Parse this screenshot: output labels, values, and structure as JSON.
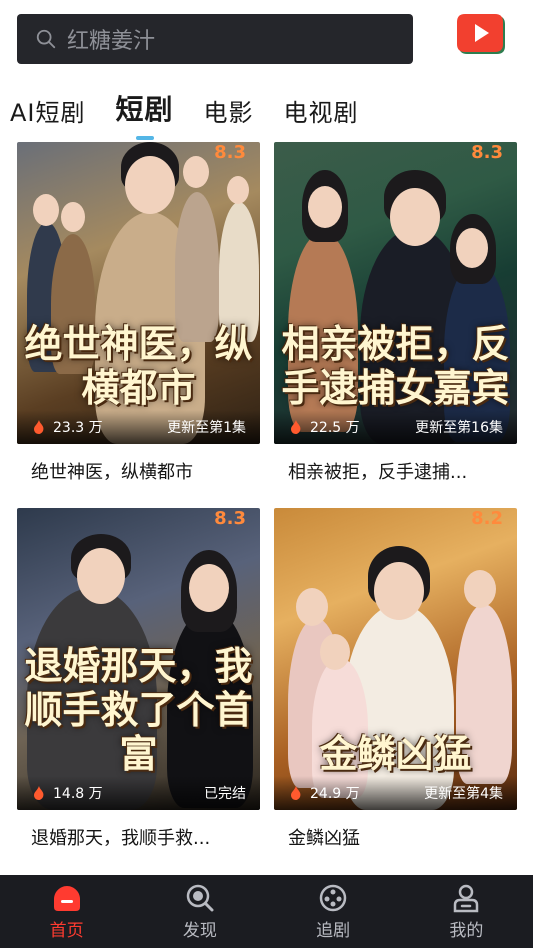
{
  "search": {
    "placeholder": "红糖姜汁"
  },
  "tabs": [
    {
      "label": "AI短剧",
      "active": false
    },
    {
      "label": "短剧",
      "active": true
    },
    {
      "label": "电影",
      "active": false
    },
    {
      "label": "电视剧",
      "active": false
    }
  ],
  "cards": [
    {
      "poster_title": "绝世神医，纵横都市",
      "score": "8.3",
      "views": "23.3 万",
      "status": "更新至第1集",
      "caption": "绝世神医，纵横都市"
    },
    {
      "poster_title": "相亲被拒，反手逮捕女嘉宾",
      "score": "8.3",
      "views": "22.5 万",
      "status": "更新至第16集",
      "caption": "相亲被拒，反手逮捕..."
    },
    {
      "poster_title": "退婚那天，我顺手救了个首富",
      "score": "8.3",
      "views": "14.8 万",
      "status": "已完结",
      "caption": "退婚那天，我顺手救..."
    },
    {
      "poster_title": "金鳞凶猛",
      "score": "8.2",
      "views": "24.9 万",
      "status": "更新至第4集",
      "caption": "金鳞凶猛"
    }
  ],
  "nav": [
    {
      "label": "首页",
      "icon": "home-icon",
      "active": true
    },
    {
      "label": "发现",
      "icon": "discover-icon",
      "active": false
    },
    {
      "label": "追剧",
      "icon": "follow-icon",
      "active": false
    },
    {
      "label": "我的",
      "icon": "profile-icon",
      "active": false
    }
  ],
  "colors": {
    "search_bg": "#25262b",
    "nav_bg": "#1b1c21",
    "accent_red": "#ff3b30",
    "tab_indicator": "#54b6e6",
    "score": "#ff8a3c"
  }
}
